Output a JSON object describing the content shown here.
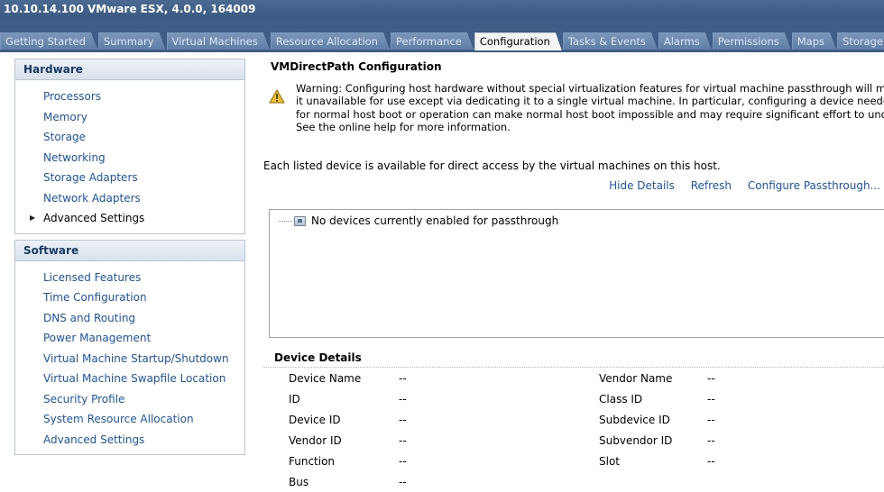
{
  "window": {
    "title": "10.10.14.100 VMware ESX, 4.0.0, 164009"
  },
  "tabs": [
    {
      "label": "Getting Started"
    },
    {
      "label": "Summary"
    },
    {
      "label": "Virtual Machines"
    },
    {
      "label": "Resource Allocation"
    },
    {
      "label": "Performance"
    },
    {
      "label": "Configuration"
    },
    {
      "label": "Tasks & Events"
    },
    {
      "label": "Alarms"
    },
    {
      "label": "Permissions"
    },
    {
      "label": "Maps"
    },
    {
      "label": "Storage Views"
    }
  ],
  "active_tab": "Configuration",
  "sidebar": {
    "hardware": {
      "title": "Hardware",
      "items": [
        {
          "label": "Processors"
        },
        {
          "label": "Memory"
        },
        {
          "label": "Storage"
        },
        {
          "label": "Networking"
        },
        {
          "label": "Storage Adapters"
        },
        {
          "label": "Network Adapters"
        },
        {
          "label": "Advanced Settings"
        }
      ]
    },
    "software": {
      "title": "Software",
      "items": [
        {
          "label": "Licensed Features"
        },
        {
          "label": "Time Configuration"
        },
        {
          "label": "DNS and Routing"
        },
        {
          "label": "Power Management"
        },
        {
          "label": "Virtual Machine Startup/Shutdown"
        },
        {
          "label": "Virtual Machine Swapfile Location"
        },
        {
          "label": "Security Profile"
        },
        {
          "label": "System Resource Allocation"
        },
        {
          "label": "Advanced Settings"
        }
      ]
    }
  },
  "main": {
    "title": "VMDirectPath Configuration",
    "warning_lines": [
      "Warning: Configuring host hardware without special virtualization features for virtual machine passthrough will make",
      "it unavailable for use except via dedicating it to a single virtual machine. In particular, configuring a device needed",
      "for normal host boot or operation can make normal host boot impossible and may require significant effort to undo.",
      "See the online help for more information."
    ],
    "description": "Each listed device is available for direct access by the virtual machines on this host.",
    "actions": {
      "hide_details": "Hide Details",
      "refresh": "Refresh",
      "configure": "Configure Passthrough..."
    },
    "device_list": {
      "empty_message": "No devices currently enabled for passthrough"
    },
    "details": {
      "title": "Device Details",
      "left": [
        {
          "label": "Device Name",
          "value": "--"
        },
        {
          "label": "ID",
          "value": "--"
        },
        {
          "label": "Device ID",
          "value": "--"
        },
        {
          "label": "Vendor ID",
          "value": "--"
        },
        {
          "label": "Function",
          "value": "--"
        },
        {
          "label": "Bus",
          "value": "--"
        }
      ],
      "right": [
        {
          "label": "Vendor Name",
          "value": "--"
        },
        {
          "label": "Class ID",
          "value": "--"
        },
        {
          "label": "Subdevice ID",
          "value": "--"
        },
        {
          "label": "Subvendor ID",
          "value": "--"
        },
        {
          "label": "Slot",
          "value": "--"
        }
      ]
    }
  }
}
